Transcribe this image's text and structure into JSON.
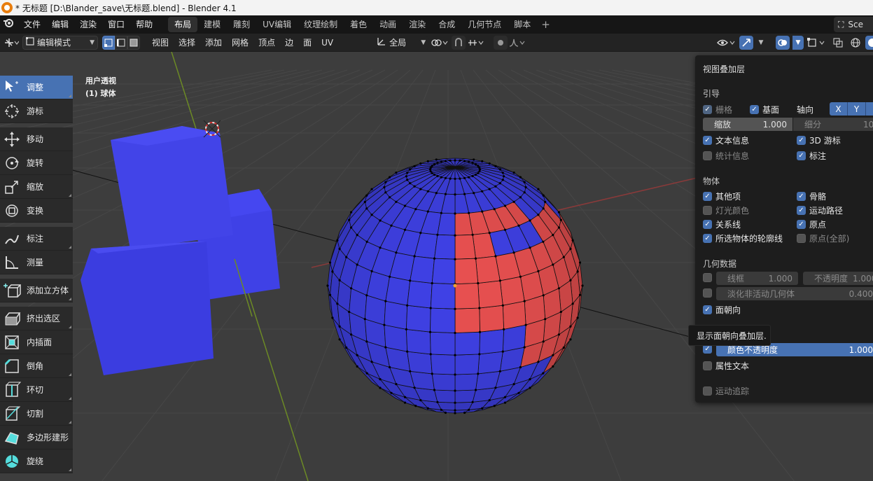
{
  "window": {
    "title": "* 无标题 [D:\\Blander_save\\无标题.blend] - Blender 4.1"
  },
  "menu": {
    "items": [
      "文件",
      "编辑",
      "渲染",
      "窗口",
      "帮助"
    ]
  },
  "workspaces": [
    {
      "label": "布局",
      "active": true
    },
    {
      "label": "建模"
    },
    {
      "label": "雕刻"
    },
    {
      "label": "UV编辑"
    },
    {
      "label": "纹理绘制"
    },
    {
      "label": "着色"
    },
    {
      "label": "动画"
    },
    {
      "label": "渲染"
    },
    {
      "label": "合成"
    },
    {
      "label": "几何节点"
    },
    {
      "label": "脚本"
    }
  ],
  "scene_label": "Sce",
  "header": {
    "mode": "编辑模式",
    "menus": [
      "视图",
      "选择",
      "添加",
      "网格",
      "顶点",
      "边",
      "面",
      "UV"
    ],
    "transform_orientation": "全局"
  },
  "viewport_info": {
    "view_name": "用户透视",
    "object_name": "(1) 球体"
  },
  "tools": [
    {
      "label": "调整",
      "icon": "select-tweak-icon",
      "active": true,
      "corner": true
    },
    {
      "label": "游标",
      "icon": "cursor-icon"
    },
    {
      "label": "移动",
      "icon": "move-icon"
    },
    {
      "label": "旋转",
      "icon": "rotate-icon"
    },
    {
      "label": "缩放",
      "icon": "scale-icon",
      "corner": true
    },
    {
      "label": "变换",
      "icon": "transform-icon"
    },
    {
      "label": "标注",
      "icon": "annotate-icon",
      "corner": true
    },
    {
      "label": "测量",
      "icon": "measure-icon"
    },
    {
      "label": "添加立方体",
      "icon": "add-cube-icon",
      "corner": true
    },
    {
      "label": "挤出选区",
      "icon": "extrude-icon",
      "corner": true
    },
    {
      "label": "内插面",
      "icon": "inset-icon"
    },
    {
      "label": "倒角",
      "icon": "bevel-icon",
      "corner": true
    },
    {
      "label": "环切",
      "icon": "loop-cut-icon",
      "corner": true
    },
    {
      "label": "切割",
      "icon": "knife-icon",
      "corner": true
    },
    {
      "label": "多边形建形",
      "icon": "poly-build-icon"
    },
    {
      "label": "旋绕",
      "icon": "spin-icon",
      "corner": true
    }
  ],
  "overlays": {
    "title": "视图叠加层",
    "guides": {
      "label": "引导",
      "grid": {
        "label": "栅格",
        "checked": true
      },
      "floor": {
        "label": "基面",
        "checked": true
      },
      "axes_label": "轴向",
      "axes": [
        "X",
        "Y"
      ],
      "scale": {
        "label": "缩放",
        "value": "1.000"
      },
      "subdivisions": {
        "label": "细分",
        "value": "10"
      },
      "text_info": {
        "label": "文本信息",
        "checked": true
      },
      "cursor_3d": {
        "label": "3D 游标",
        "checked": true
      },
      "statistics": {
        "label": "统计信息",
        "checked": false
      },
      "annotations": {
        "label": "标注",
        "checked": true
      }
    },
    "objects": {
      "label": "物体",
      "extras": {
        "label": "其他项",
        "checked": true
      },
      "bones": {
        "label": "骨骼",
        "checked": true
      },
      "light_colors": {
        "label": "灯光颜色",
        "checked": false
      },
      "motion_paths": {
        "label": "运动路径",
        "checked": true
      },
      "relationship_lines": {
        "label": "关系线",
        "checked": true
      },
      "origins": {
        "label": "原点",
        "checked": true
      },
      "outline_selected": {
        "label": "所选物体的轮廓线",
        "checked": true
      },
      "origins_all": {
        "label": "原点(全部)",
        "checked": false
      }
    },
    "geometry": {
      "label": "几何数据",
      "wireframe": {
        "label": "线框",
        "value": "1.000",
        "checked": false
      },
      "opacity": {
        "label": "不透明度",
        "value": "1.000"
      },
      "fade_inactive": {
        "label": "淡化非活动几何体",
        "value": "0.400",
        "checked": false
      },
      "face_orientation": {
        "label": "面朝向",
        "checked": true
      }
    },
    "color_opacity": {
      "label": "颜色不透明度",
      "value": "1.000",
      "checked": true
    },
    "attribute_text": {
      "label": "属性文本",
      "checked": false
    },
    "motion_tracking": {
      "label": "运动追踪",
      "checked": false
    }
  },
  "tooltip": "显示面朝向叠加层.",
  "colors": {
    "accent": "#4772b3",
    "front_face": "#3f41e6",
    "back_face": "#e85050",
    "bg": "#3d3d3d"
  }
}
